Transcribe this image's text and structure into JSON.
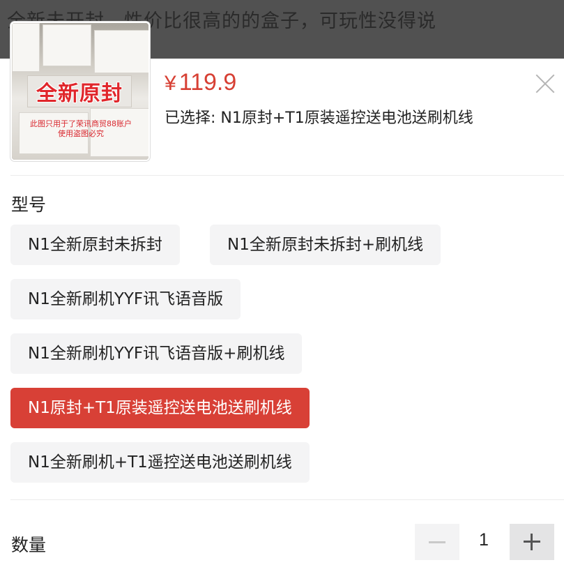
{
  "background_page": {
    "description_text": "全新未开封，性价比很高的的盒子，可玩性没得说"
  },
  "product": {
    "thumbnail": {
      "banner_text": "全新原封",
      "watermark_line1": "此图只用于了荣讯商贸88账户",
      "watermark_line2": "使用盗图必究"
    },
    "price_symbol": "¥",
    "price": "119.9",
    "selected_label": "已选择: N1原封+T1原装遥控送电池送刷机线",
    "close_icon": "close-icon"
  },
  "model_section": {
    "title": "型号",
    "options": [
      {
        "label": "N1全新原封未拆封",
        "selected": false
      },
      {
        "label": "N1全新原封未拆封+刷机线",
        "selected": false
      },
      {
        "label": "N1全新刷机YYF讯飞语音版",
        "selected": false
      },
      {
        "label": "N1全新刷机YYF讯飞语音版+刷机线",
        "selected": false
      },
      {
        "label": "N1原封+T1原装遥控送电池送刷机线",
        "selected": true
      },
      {
        "label": "N1全新刷机+T1遥控送电池送刷机线",
        "selected": false
      }
    ]
  },
  "quantity_section": {
    "title": "数量",
    "value": "1",
    "decrement_icon": "minus-icon",
    "increment_icon": "plus-icon"
  },
  "colors": {
    "accent": "#d84036",
    "price": "#d74034",
    "chip_bg": "#f4f4f5",
    "overlay": "#515151"
  }
}
